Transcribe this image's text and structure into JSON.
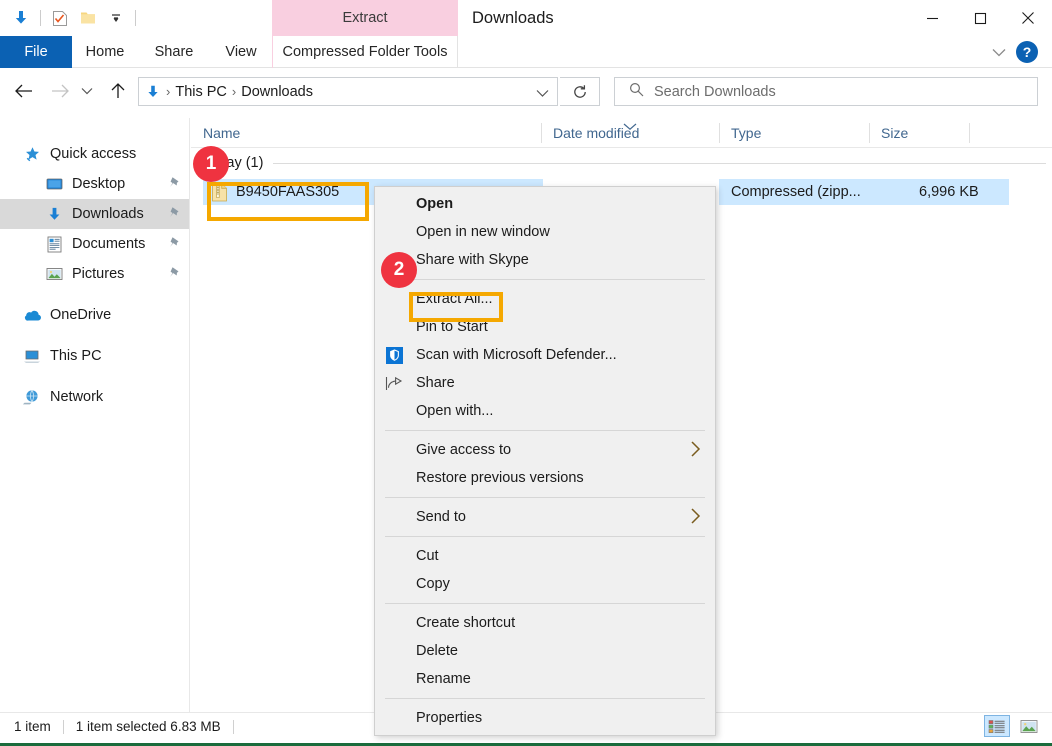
{
  "window": {
    "title": "Downloads",
    "contextual_tab_group": "Extract",
    "controls": {
      "minimize": "minimize-icon",
      "maximize": "maximize-icon",
      "close": "close-icon",
      "help": "?"
    }
  },
  "quick_access_toolbar": {
    "items": [
      {
        "name": "downloads-icon",
        "label": "Downloads"
      },
      {
        "name": "properties-icon",
        "label": "Properties"
      },
      {
        "name": "new-folder-icon",
        "label": "New folder"
      },
      {
        "name": "customize-dropdown-icon",
        "label": "Customize Quick Access Toolbar"
      }
    ]
  },
  "ribbon": {
    "tabs": [
      {
        "label": "File",
        "active": false
      },
      {
        "label": "Home",
        "active": false
      },
      {
        "label": "Share",
        "active": false
      },
      {
        "label": "View",
        "active": false
      },
      {
        "label": "Compressed Folder Tools",
        "active": true
      }
    ],
    "collapse_icon": "chevron-down-icon"
  },
  "address_bar": {
    "back": "back-arrow-icon",
    "forward": "forward-arrow-icon",
    "recent": "chevron-down-icon",
    "up": "up-arrow-icon",
    "breadcrumb": [
      "This PC",
      "Downloads"
    ],
    "breadcrumb_icon": "downloads-icon",
    "dropdown": "chevron-down-icon",
    "refresh": "refresh-icon"
  },
  "search": {
    "placeholder": "Search Downloads",
    "icon": "search-icon"
  },
  "sidebar": {
    "items": [
      {
        "label": "Quick access",
        "icon": "star-pin-icon",
        "level": 0,
        "selected": false,
        "pinned": false
      },
      {
        "label": "Desktop",
        "icon": "desktop-icon",
        "level": 1,
        "selected": false,
        "pinned": true
      },
      {
        "label": "Downloads",
        "icon": "downloads-icon",
        "level": 1,
        "selected": true,
        "pinned": true
      },
      {
        "label": "Documents",
        "icon": "documents-icon",
        "level": 1,
        "selected": false,
        "pinned": true
      },
      {
        "label": "Pictures",
        "icon": "pictures-icon",
        "level": 1,
        "selected": false,
        "pinned": true
      },
      {
        "label": "OneDrive",
        "icon": "onedrive-icon",
        "level": 0,
        "selected": false,
        "pinned": false
      },
      {
        "label": "This PC",
        "icon": "this-pc-icon",
        "level": 0,
        "selected": false,
        "pinned": false
      },
      {
        "label": "Network",
        "icon": "network-icon",
        "level": 0,
        "selected": false,
        "pinned": false
      }
    ]
  },
  "file_list": {
    "columns": [
      {
        "label": "Name",
        "sorted": false
      },
      {
        "label": "Date modified",
        "sorted": true
      },
      {
        "label": "Type",
        "sorted": false
      },
      {
        "label": "Size",
        "sorted": false
      }
    ],
    "group_header": "Today (1)",
    "rows": [
      {
        "name": "B9450FAAS305",
        "icon": "zip-file-icon",
        "date_modified": "",
        "type": "Compressed (zipp...",
        "size": "6,996 KB",
        "selected": true
      }
    ]
  },
  "context_menu": {
    "items": [
      {
        "label": "Open",
        "bold": true,
        "icon": null,
        "submenu": false,
        "separator_after": false
      },
      {
        "label": "Open in new window",
        "bold": false,
        "icon": null,
        "submenu": false,
        "separator_after": false
      },
      {
        "label": "Share with Skype",
        "bold": false,
        "icon": null,
        "submenu": false,
        "separator_after": true
      },
      {
        "label": "Extract All...",
        "bold": false,
        "icon": null,
        "submenu": false,
        "separator_after": false
      },
      {
        "label": "Pin to Start",
        "bold": false,
        "icon": null,
        "submenu": false,
        "separator_after": false
      },
      {
        "label": "Scan with Microsoft Defender...",
        "bold": false,
        "icon": "defender-shield-icon",
        "submenu": false,
        "separator_after": false
      },
      {
        "label": "Share",
        "bold": false,
        "icon": "share-icon",
        "submenu": false,
        "separator_after": false
      },
      {
        "label": "Open with...",
        "bold": false,
        "icon": null,
        "submenu": false,
        "separator_after": true
      },
      {
        "label": "Give access to",
        "bold": false,
        "icon": null,
        "submenu": true,
        "separator_after": false
      },
      {
        "label": "Restore previous versions",
        "bold": false,
        "icon": null,
        "submenu": false,
        "separator_after": true
      },
      {
        "label": "Send to",
        "bold": false,
        "icon": null,
        "submenu": true,
        "separator_after": true
      },
      {
        "label": "Cut",
        "bold": false,
        "icon": null,
        "submenu": false,
        "separator_after": false
      },
      {
        "label": "Copy",
        "bold": false,
        "icon": null,
        "submenu": false,
        "separator_after": true
      },
      {
        "label": "Create shortcut",
        "bold": false,
        "icon": null,
        "submenu": false,
        "separator_after": false
      },
      {
        "label": "Delete",
        "bold": false,
        "icon": null,
        "submenu": false,
        "separator_after": false
      },
      {
        "label": "Rename",
        "bold": false,
        "icon": null,
        "submenu": false,
        "separator_after": true
      },
      {
        "label": "Properties",
        "bold": false,
        "icon": null,
        "submenu": false,
        "separator_after": false
      }
    ]
  },
  "status_bar": {
    "item_count": "1 item",
    "selection": "1 item selected  6.83 MB",
    "views": [
      {
        "name": "details-view-button",
        "selected": true
      },
      {
        "name": "large-icons-view-button",
        "selected": false
      }
    ]
  },
  "annotations": {
    "badges": [
      {
        "number": "1",
        "target": "file-item"
      },
      {
        "number": "2",
        "target": "extract-all-menu-item"
      }
    ],
    "highlight_color": "#f5a800",
    "badge_color": "#ef3340"
  }
}
